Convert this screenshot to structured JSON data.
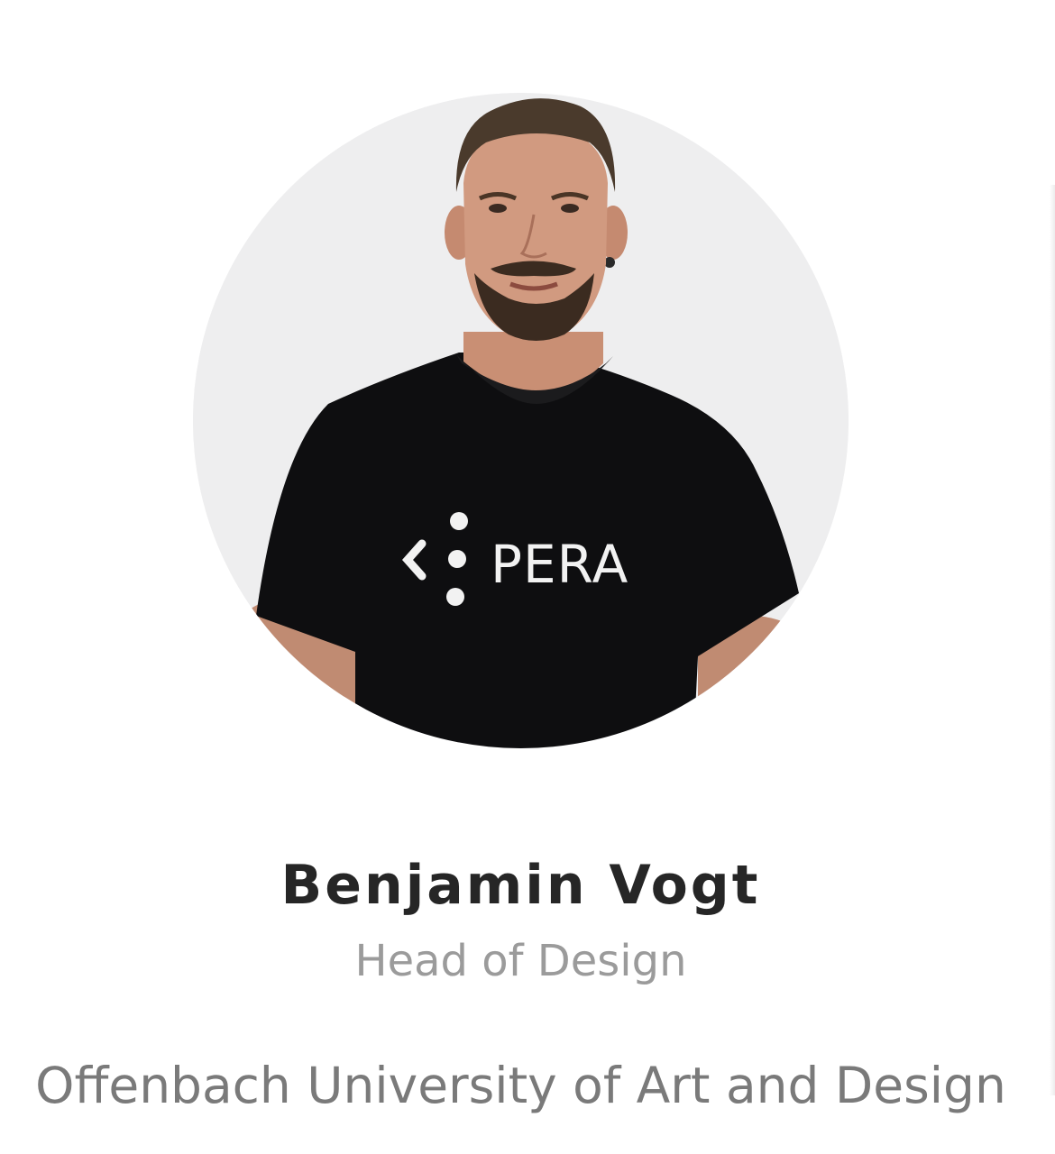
{
  "profile": {
    "name": "Benjamin Vogt",
    "role": "Head of Design",
    "organization": "Offenbach University of Art and Design"
  },
  "avatar": {
    "shirt_text": "PERA",
    "shirt_logo": "code-bracket-dots-logo"
  },
  "colors": {
    "background": "#ffffff",
    "avatar_background": "#eeeeef",
    "name": "#262626",
    "role": "#9b9b9b",
    "organization": "#7a7a7a",
    "shirt": "#0e0e10"
  }
}
